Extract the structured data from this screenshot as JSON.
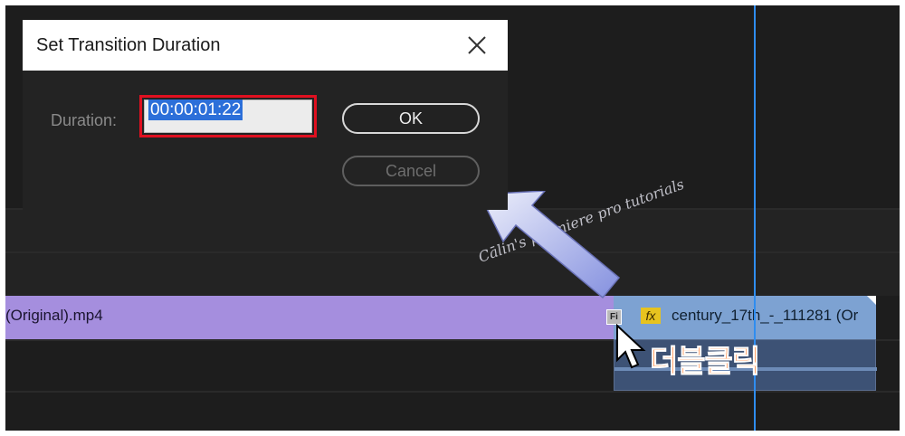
{
  "dialog": {
    "title": "Set Transition Duration",
    "duration_label": "Duration:",
    "duration_value": "00:00:01:22",
    "ok_label": "OK",
    "cancel_label": "Cancel"
  },
  "timeline": {
    "clip_left_label": "(Original).mp4",
    "clip_right_label": "century_17th_-_111281 (Or",
    "fx_badge": "fx",
    "transition_marker": "Fi"
  },
  "annotation": {
    "double_click_text": "더블클릭",
    "watermark": "Cālin's premiere pro tutorials"
  },
  "colors": {
    "clip_left": "#a58ede",
    "clip_right": "#7da2d2",
    "playhead": "#2f8df0",
    "highlight_box": "#e01020",
    "annotation_text": "#ff7a2a"
  }
}
